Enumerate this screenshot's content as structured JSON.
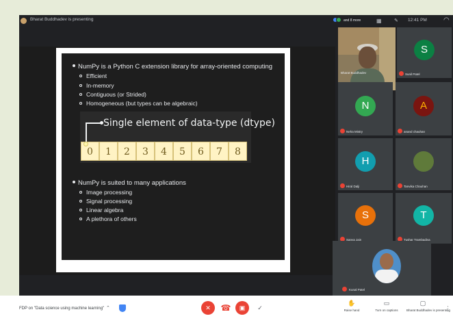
{
  "presenter_bar": {
    "text": "Bharat Buddhadev is presenting"
  },
  "status": {
    "people_text": "and 8 more",
    "clock": "12:41 PM"
  },
  "slide": {
    "bullet1": "NumPy is a Python C extension library for array-oriented computing",
    "sub1": [
      "Efficient",
      "In-memory",
      "Contiguous (or Strided)",
      "Homogeneous (but types can be algebraic)"
    ],
    "dtype_label": "Single element of data-type (dtype)",
    "cells": [
      "0",
      "1",
      "2",
      "3",
      "4",
      "5",
      "6",
      "7",
      "8"
    ],
    "bullet2": "NumPy is suited to many applications",
    "sub2": [
      "Image processing",
      "Signal processing",
      "Linear algebra",
      "A plethora of others"
    ]
  },
  "participants": {
    "main_video_name": "Bharat Buddhadev",
    "tiles": [
      {
        "initial": "S",
        "name": "Sunil Patel",
        "color": "#0b8043"
      },
      {
        "initial": "N",
        "name": "Neha Mistry",
        "color": "#33a852"
      },
      {
        "initial": "A",
        "name": "anand chauhan",
        "color": "#c5221f"
      },
      {
        "initial": "H",
        "name": "Hiral Dalji",
        "color": "#129eaf"
      },
      {
        "initial": "",
        "name": "Tanvika Chauhan",
        "color": "#5f7a3a"
      },
      {
        "initial": "S",
        "name": "Sanya Jain",
        "color": "#e8710a"
      },
      {
        "initial": "T",
        "name": "Tushar Trambadiya",
        "color": "#12b5a6"
      }
    ],
    "self_name": "Kunal Patel"
  },
  "bottom_bar": {
    "meeting_title": "FDP on \"Data science using machine learning\"",
    "raise_hand": "Raise hand",
    "captions": "Turn on captions",
    "presenting": "Bharat Buddhadev is presenting"
  },
  "icons": {
    "mic": "mic-off-icon",
    "end_call": "end-call-icon",
    "camera": "camera-off-icon",
    "hand": "hand-icon",
    "captions": "captions-icon",
    "present": "present-icon"
  },
  "colors": {
    "accent_red": "#ea4335",
    "meet_dark": "#202124",
    "tile_bg": "#3c4043",
    "cell_fill": "#fff3c4"
  }
}
